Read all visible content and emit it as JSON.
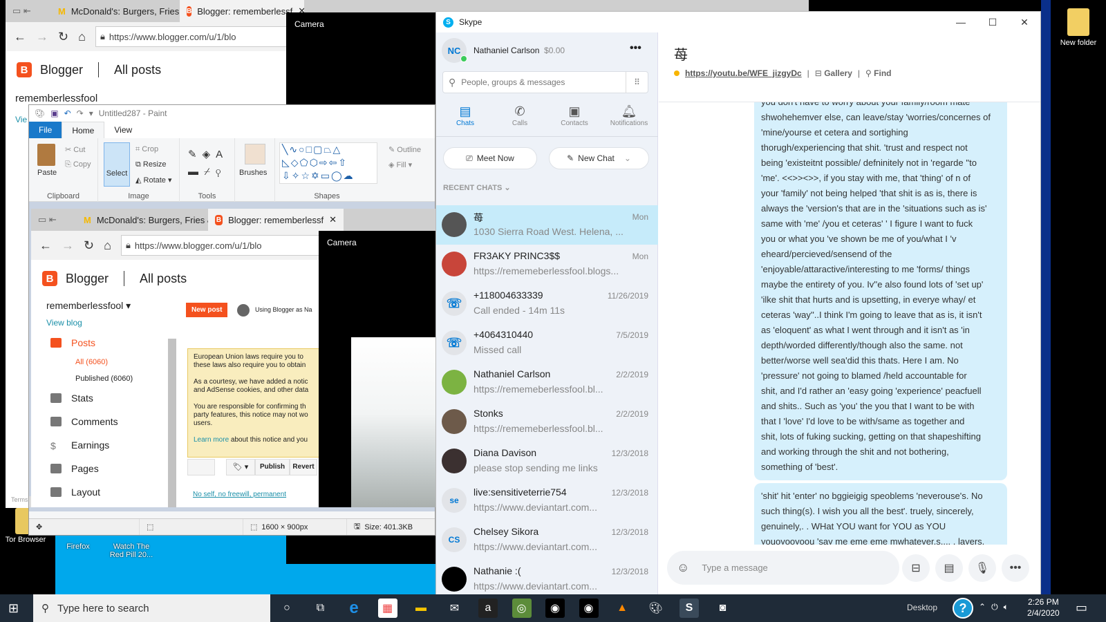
{
  "desktop": {
    "icons": [
      {
        "label": "Tor Browser"
      },
      {
        "label": "Firefox"
      },
      {
        "label": "Watch The Red Pill 20..."
      },
      {
        "label": "New folder"
      }
    ]
  },
  "browser": {
    "tabs": [
      {
        "label": "McDonald's: Burgers, Fries &",
        "icon": "mcdonalds-icon"
      },
      {
        "label": "Blogger: rememberlessf",
        "icon": "blogger-icon"
      }
    ],
    "url": "https://www.blogger.com/u/1/blo",
    "brand": "Blogger",
    "section": "All posts",
    "blog_name": "rememberlessfool",
    "view_blog": "View blog",
    "new_post": "New post",
    "using_as": "Using Blogger as Na",
    "sidebar": [
      {
        "label": "Posts"
      },
      {
        "label": "All (6060)"
      },
      {
        "label": "Published (6060)"
      },
      {
        "label": "Stats"
      },
      {
        "label": "Comments"
      },
      {
        "label": "Earnings"
      },
      {
        "label": "Pages"
      },
      {
        "label": "Layout"
      }
    ],
    "notice": [
      "European Union laws require you to",
      "these laws also require you to obtain",
      "As a courtesy, we have added a notic",
      "and AdSense cookies, and other data",
      "You are responsible for confirming th",
      "party features, this notice may not wo",
      "users."
    ],
    "learn_more": "Learn more",
    "learn_more_rest": "about this notice and you",
    "publish": "Publish",
    "revert": "Revert",
    "post_title": "No self, no freewill, permanent",
    "terms": "Terms"
  },
  "camera": {
    "title": "Camera"
  },
  "paint": {
    "title": "Untitled287 - Paint",
    "tabs": [
      "File",
      "Home",
      "View"
    ],
    "clipboard": {
      "paste": "Paste",
      "cut": "Cut",
      "copy": "Copy",
      "label": "Clipboard"
    },
    "image": {
      "select": "Select",
      "crop": "Crop",
      "resize": "Resize",
      "rotate": "Rotate",
      "label": "Image"
    },
    "tools": {
      "label": "Tools"
    },
    "brushes": "Brushes",
    "shapes": {
      "label": "Shapes",
      "outline": "Outline",
      "fill": "Fill"
    },
    "status": {
      "dimensions": "1600 × 900px",
      "size": "Size: 401.3KB"
    }
  },
  "skype": {
    "title": "Skype",
    "profile": {
      "initials": "NC",
      "name": "Nathaniel Carlson",
      "credit": "$0.00"
    },
    "search_placeholder": "People, groups & messages",
    "nav": [
      {
        "label": "Chats",
        "icon": "chat-icon",
        "active": true
      },
      {
        "label": "Calls",
        "icon": "phone-icon"
      },
      {
        "label": "Contacts",
        "icon": "contacts-icon"
      },
      {
        "label": "Notifications",
        "icon": "bell-icon"
      }
    ],
    "meet_now": "Meet Now",
    "new_chat": "New Chat",
    "recent_chats": "RECENT CHATS",
    "chats": [
      {
        "name": "苺",
        "preview": "1030 Sierra Road West. Helena, ...",
        "date": "Mon",
        "avatar": "",
        "color": "#555",
        "selected": true
      },
      {
        "name": "FR3AKY PRINC3$$",
        "preview": "https://rememeberlessfool.blogs...",
        "date": "Mon",
        "avatar": "",
        "color": "#c8453a"
      },
      {
        "name": "+118004633339",
        "preview": "Call ended - 14m 11s",
        "date": "11/26/2019",
        "avatar": "☏",
        "color": "#e2e4e8"
      },
      {
        "name": "+4064310440",
        "preview": "Missed call",
        "date": "7/5/2019",
        "avatar": "☏",
        "color": "#e2e4e8"
      },
      {
        "name": "Nathaniel Carlson",
        "preview": "https://rememeberlessfool.bl...",
        "date": "2/2/2019",
        "avatar": "",
        "color": "#7cb342"
      },
      {
        "name": "Stonks",
        "preview": "https://rememeberlessfool.bl...",
        "date": "2/2/2019",
        "avatar": "",
        "color": "#6d5a4a"
      },
      {
        "name": "Diana Davison",
        "preview": "please stop sending me links",
        "date": "12/3/2018",
        "avatar": "",
        "color": "#3b3030"
      },
      {
        "name": "live:sensitiveterrie754",
        "preview": "https://www.deviantart.com...",
        "date": "12/3/2018",
        "avatar": "se",
        "color": "#e2e4e8"
      },
      {
        "name": "Chelsey Sikora",
        "preview": "https://www.deviantart.com...",
        "date": "12/3/2018",
        "avatar": "CS",
        "color": "#e2e4e8"
      },
      {
        "name": "Nathanie :(",
        "preview": "https://www.deviantart.com...",
        "date": "12/3/2018",
        "avatar": "",
        "color": "#000"
      }
    ],
    "conversation": {
      "title": "苺",
      "link": "https://youtu.be/WFE_jizgyDc",
      "gallery": "Gallery",
      "find": "Find",
      "messages": [
        {
          "lines": [
            "you don't have to worry about your family/room mate",
            "shwohehemver else, can leave/stay 'worries/concernes of",
            "'mine/yourse et cetera and sortighing",
            "thorugh/experiencing that shit.  'trust and respect not",
            "being 'existeitnt possible/ defninitely not in 'regarde ''to",
            "'me'. <<>><>>, if you stay with me, that 'thing' of n of",
            "your 'family' not being helped 'that shit is as is, there is",
            "always the 'version's that are in the 'situations such as is'",
            "same with 'me' /you et ceteras' ' I figure I want to fuck",
            "you or what you 've shown be me of you/what I 'v",
            "eheard/percieved/sensend of the",
            "'enjoyable/attaractive/interesting to me 'forms/ things",
            "maybe the entirety of you. Iv''e also found lots of 'set up'",
            "'ilke shit that hurts and is upsetting, in everye whay/ et",
            "ceteras 'way''..I think I'm going to leave that as is, it isn't",
            "as 'eloquent' as what I went through and it isn't as 'in",
            "depth/worded differently/though also the same. not",
            "better/worse well sea'did this thats. Here I am. No",
            "'pressure' not going to blamed /held accountable for",
            "shit, and I'd rather an 'easy going 'experience' peacfuell",
            "and shits.. Such as 'you' the you that I want to be with",
            "that I  'love' I'd love to be with/same as together and",
            "shit, lots of fuking sucking, getting on that shapeshifting",
            "and working through the shit and not bothering,",
            "something of 'best'."
          ]
        },
        {
          "lines": [
            "'shit' hit 'enter' no bggieigig speoblems 'neverouse's. No",
            "such thing(s). I wish you all the best'. truely, sincerely,",
            "genuinely,. . WHat YOU want for YOU as YOU",
            "youoyooyoou 'say me eme eme mwhatever.s.... . layers."
          ]
        }
      ],
      "input_placeholder": "Type a message"
    },
    "accent": "#0078d4"
  },
  "taskbar": {
    "search_placeholder": "Type here to search",
    "apps": [
      "cortana-icon",
      "task-view-icon",
      "edge-icon",
      "store-icon",
      "file-explorer-icon",
      "mail-icon",
      "amazon-icon",
      "tripadvisor-icon",
      "webcam-icon",
      "camera-app-icon",
      "vlc-icon",
      "paint-icon",
      "skype-icon",
      "camera-icon"
    ],
    "desktop_label": "Desktop",
    "time": "2:26 PM",
    "date": "2/4/2020"
  }
}
